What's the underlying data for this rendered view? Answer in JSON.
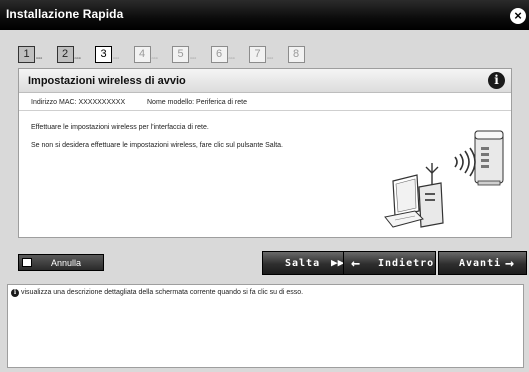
{
  "window": {
    "title": "Installazione Rapida",
    "close_glyph": "×"
  },
  "steps": [
    {
      "num": "1",
      "state": "done"
    },
    {
      "num": "2",
      "state": "done"
    },
    {
      "num": "3",
      "state": "active"
    },
    {
      "num": "4",
      "state": "pending"
    },
    {
      "num": "5",
      "state": "pending"
    },
    {
      "num": "6",
      "state": "pending"
    },
    {
      "num": "7",
      "state": "pending"
    },
    {
      "num": "8",
      "state": "pending"
    }
  ],
  "step_dots": "▫▫▫",
  "panel": {
    "title": "Impostazioni wireless di avvio",
    "info_glyph": "i",
    "mac_label": "Indirizzo MAC: XXXXXXXXXX",
    "model_label": "Nome modello: Periferica di rete",
    "description_1": "Effettuare le impostazioni wireless per l'interfaccia di rete.",
    "description_2": "Se non si desidera effettuare le impostazioni wireless, fare clic sul pulsante Salta."
  },
  "buttons": {
    "annulla": "Annulla",
    "salta": "Salta",
    "salta_icon": "▶▶|",
    "indietro": "Indietro",
    "indietro_icon": "🡐",
    "avanti": "Avanti",
    "avanti_icon": "🡒"
  },
  "help": {
    "icon_glyph": "i",
    "text": "visualizza una descrizione dettagliata della schermata corrente quando si fa clic su di esso."
  },
  "colors": {
    "titlebar": "#000000",
    "background": "#d9d9d9",
    "panel": "#ffffff",
    "button_dark": "#2e2e2e"
  }
}
